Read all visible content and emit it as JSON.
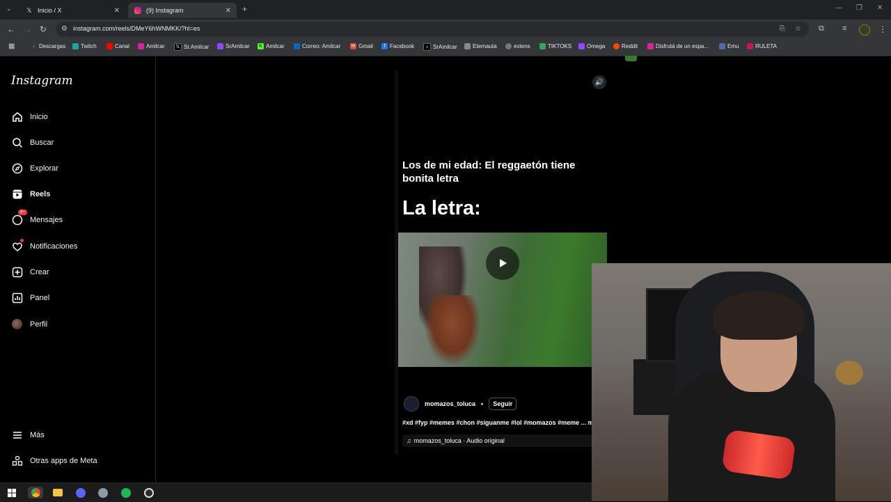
{
  "browser": {
    "tabs": [
      {
        "title": "Inicio / X",
        "icon": "x-logo-icon"
      },
      {
        "title": "(9) Instagram",
        "icon": "instagram-icon",
        "active": true
      }
    ],
    "url": "instagram.com/reels/DMeY6hWNMKK/?hl=es",
    "bookmarks": [
      {
        "label": "Descargas",
        "color": "#9aa0a6"
      },
      {
        "label": "Twitch",
        "color": "#1fa2a2"
      },
      {
        "label": "Canal",
        "color": "#ff0000"
      },
      {
        "label": "Amilcar",
        "color": "#d6249f"
      },
      {
        "label": "Sr.Amilcar",
        "color": "#000000"
      },
      {
        "label": "SrAmilcar",
        "color": "#9146ff"
      },
      {
        "label": "Amilcar",
        "color": "#53fc18"
      },
      {
        "label": "Correo: Amilcar",
        "color": "#0a66c2"
      },
      {
        "label": "Gmail",
        "color": "#ea4335"
      },
      {
        "label": "Facebook",
        "color": "#1877f2"
      },
      {
        "label": "SrAmilcar",
        "color": "#000000"
      },
      {
        "label": "Eternauta",
        "color": "#888888"
      },
      {
        "label": "extens",
        "color": "#cccccc"
      },
      {
        "label": "TIKTOKS",
        "color": "#34a853"
      },
      {
        "label": "Omega",
        "color": "#9146ff"
      },
      {
        "label": "Reddit",
        "color": "#ff4500"
      },
      {
        "label": "Disfrutá de un espa...",
        "color": "#d6249f"
      },
      {
        "label": "Emu",
        "color": "#4a6fa5"
      },
      {
        "label": "RULETA",
        "color": "#c2185b"
      }
    ]
  },
  "sidebar": {
    "logo": "Instagram",
    "items": [
      {
        "label": "Inicio",
        "icon": "home-icon"
      },
      {
        "label": "Buscar",
        "icon": "search-icon"
      },
      {
        "label": "Explorar",
        "icon": "compass-icon"
      },
      {
        "label": "Reels",
        "icon": "reels-icon"
      },
      {
        "label": "Mensajes",
        "icon": "messenger-icon",
        "badge": "9+"
      },
      {
        "label": "Notificaciones",
        "icon": "heart-icon"
      },
      {
        "label": "Crear",
        "icon": "plus-square-icon"
      },
      {
        "label": "Panel",
        "icon": "chart-icon"
      },
      {
        "label": "Perfil",
        "icon": "avatar"
      }
    ],
    "footer": [
      {
        "label": "Más",
        "icon": "menu-icon"
      },
      {
        "label": "Otras apps de Meta",
        "icon": "meta-apps-icon"
      }
    ]
  },
  "reel": {
    "title": "Los de mi edad: El reggaetón tiene bonita letra",
    "big_text": "La letra:",
    "author": "momazos_toluca",
    "separator": "•",
    "follow": "Seguir",
    "caption": "#xd #fyp #memes #chon #siguanme #lol #momazos #meme ... más",
    "audio": "momazos_toluca · Audio original"
  }
}
